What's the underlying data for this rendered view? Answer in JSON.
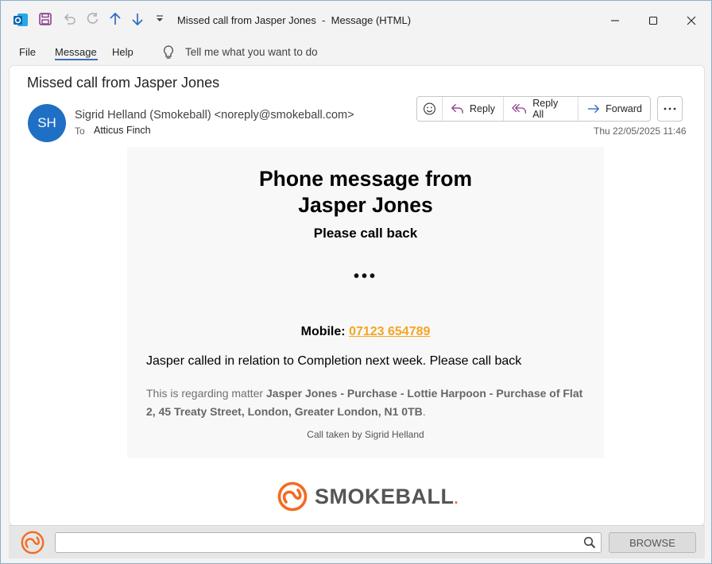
{
  "window": {
    "title": "Missed call from Jasper Jones  -  Message (HTML)"
  },
  "menu": {
    "file": "File",
    "message": "Message",
    "help": "Help",
    "tell_me": "Tell me what you want to do"
  },
  "email": {
    "subject": "Missed call from Jasper Jones",
    "avatar_initials": "SH",
    "sender": "Sigrid Helland (Smokeball) <noreply@smokeball.com>",
    "to_label": "To",
    "to_name": "Atticus Finch",
    "date": "Thu 22/05/2025 11:46"
  },
  "actions": {
    "reply": "Reply",
    "reply_all": "Reply All",
    "forward": "Forward"
  },
  "message": {
    "heading_line1": "Phone message from",
    "heading_line2": "Jasper Jones",
    "subheading": "Please call back",
    "dots": "•••",
    "mobile_label": "Mobile:",
    "mobile_number": "07123 654789",
    "note": "Jasper called in relation to Completion next week. Please call back",
    "regarding_prefix": "This is regarding matter ",
    "regarding_matter": "Jasper Jones - Purchase - Lottie Harpoon - Purchase of Flat 2, 45 Treaty Street, London, Greater London, N1 0TB",
    "regarding_suffix": ".",
    "taken_by": "Call taken by Sigrid Helland"
  },
  "brand": {
    "logo_text": "SMOKEBALL",
    "logo_mark": ".",
    "accent_color": "#f26b21"
  },
  "bottombar": {
    "search_value": "",
    "browse_label": "BROWSE"
  }
}
